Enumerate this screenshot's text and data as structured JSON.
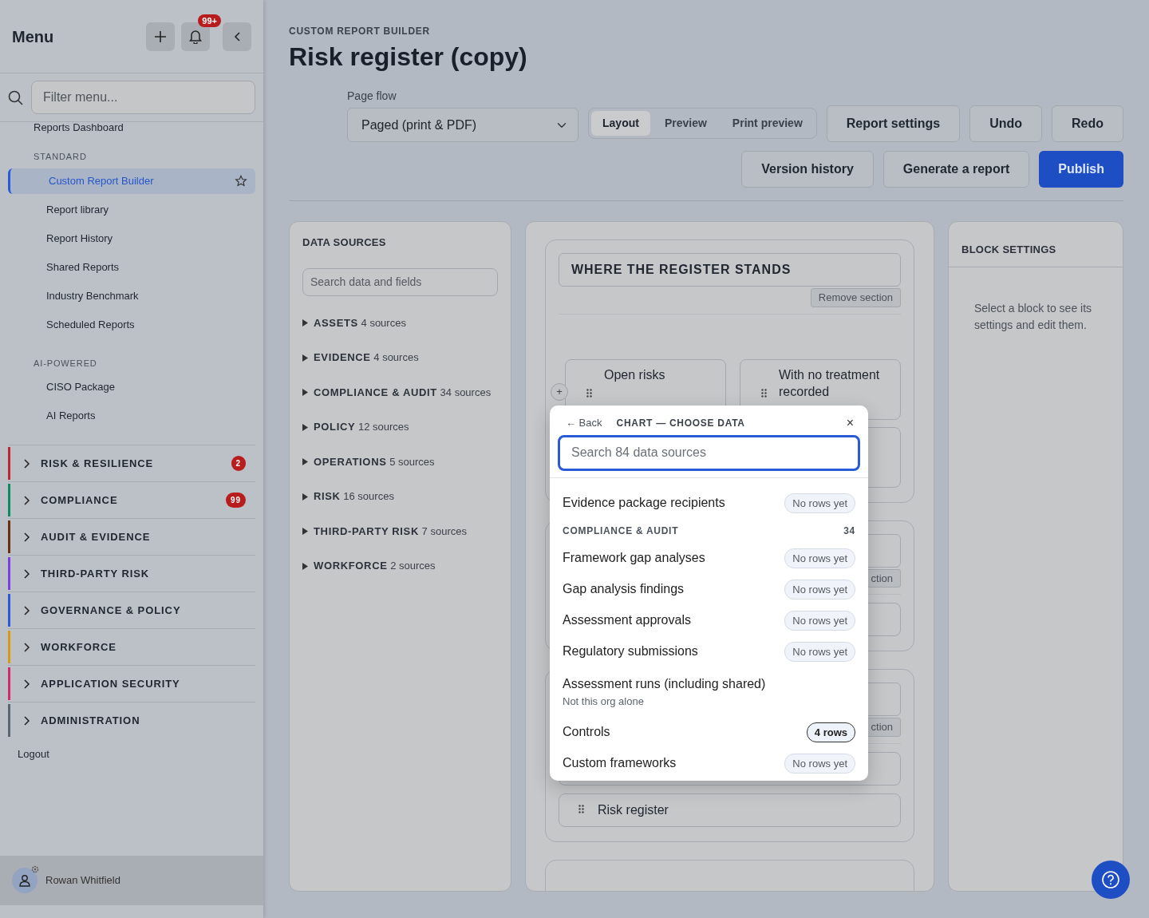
{
  "sidebar": {
    "title": "Menu",
    "notification_badge": "99+",
    "filter": {
      "placeholder": "Filter menu..."
    },
    "top_link": "Reports Dashboard",
    "sections": [
      {
        "heading": "STANDARD",
        "items": [
          {
            "label": "Custom Report Builder",
            "selected": true
          },
          {
            "label": "Report library",
            "selected": false
          },
          {
            "label": "Report History",
            "selected": false
          },
          {
            "label": "Shared Reports",
            "selected": false
          },
          {
            "label": "Industry Benchmark",
            "selected": false
          },
          {
            "label": "Scheduled Reports",
            "selected": false
          }
        ]
      },
      {
        "heading": "AI-POWERED",
        "items": [
          {
            "label": "CISO Package",
            "selected": false
          },
          {
            "label": "AI Reports",
            "selected": false
          }
        ]
      }
    ],
    "groups": [
      {
        "label": "RISK & RESILIENCE",
        "color": "#c0262d",
        "badge": "2"
      },
      {
        "label": "COMPLIANCE",
        "color": "#0e8a5f",
        "badge": "99"
      },
      {
        "label": "AUDIT & EVIDENCE",
        "color": "#6b2f12"
      },
      {
        "label": "THIRD-PARTY RISK",
        "color": "#7b3fe0"
      },
      {
        "label": "GOVERNANCE & POLICY",
        "color": "#2a5bd7"
      },
      {
        "label": "WORKFORCE",
        "color": "#d99a12"
      },
      {
        "label": "APPLICATION SECURITY",
        "color": "#d42a6a"
      },
      {
        "label": "ADMINISTRATION",
        "color": "#5b6472"
      }
    ],
    "logout": "Logout",
    "user": "Rowan Whitfield"
  },
  "header": {
    "eyebrow": "CUSTOM REPORT BUILDER",
    "title": "Risk register (copy)",
    "page_flow": {
      "label": "Page flow",
      "value": "Paged (print & PDF)"
    },
    "view_tabs": [
      {
        "label": "Layout",
        "selected": true
      },
      {
        "label": "Preview",
        "selected": false
      },
      {
        "label": "Print preview",
        "selected": false
      }
    ],
    "toolbar_buttons": [
      {
        "label": "Report settings",
        "kind": "outline"
      },
      {
        "label": "Undo",
        "kind": "outline"
      },
      {
        "label": "Redo",
        "kind": "outline"
      }
    ],
    "action_buttons": [
      {
        "label": "Version history",
        "kind": "outline"
      },
      {
        "label": "Generate a report",
        "kind": "outline"
      },
      {
        "label": "Publish",
        "kind": "primary"
      }
    ]
  },
  "data_sources": {
    "title": "DATA SOURCES",
    "search": {
      "placeholder": "Search data and fields"
    },
    "groups": [
      {
        "name": "ASSETS",
        "count": "4 sources"
      },
      {
        "name": "EVIDENCE",
        "count": "4 sources"
      },
      {
        "name": "COMPLIANCE & AUDIT",
        "count": "34 sources"
      },
      {
        "name": "POLICY",
        "count": "12 sources"
      },
      {
        "name": "OPERATIONS",
        "count": "5 sources"
      },
      {
        "name": "RISK",
        "count": "16 sources"
      },
      {
        "name": "THIRD-PARTY RISK",
        "count": "7 sources"
      },
      {
        "name": "WORKFORCE",
        "count": "2 sources"
      }
    ]
  },
  "canvas": {
    "sections": [
      {
        "title": "WHERE THE REGISTER STANDS",
        "remove": "Remove section",
        "add_block": "+",
        "blocks": [
          {
            "kind": "metric",
            "label": "Open risks"
          },
          {
            "kind": "metric",
            "label": "With no treatment recorded"
          },
          {
            "kind": "metric"
          }
        ]
      },
      {
        "remove": "ction",
        "blocks": [
          {
            "kind": "wide"
          }
        ]
      },
      {
        "remove": "ction",
        "blocks": [
          {
            "kind": "wide"
          },
          {
            "kind": "wide",
            "label": "Risk register"
          }
        ]
      },
      {
        "kind": "partial"
      }
    ]
  },
  "block_settings": {
    "title": "BLOCK SETTINGS",
    "hint": "Select a block to see its settings and edit them."
  },
  "popover": {
    "back": "← Back",
    "title": "CHART — CHOOSE DATA",
    "close": "×",
    "search": {
      "placeholder": "Search 84 data sources"
    },
    "items": [
      {
        "kind": "source",
        "name": "Evidence package recipients",
        "status": "No rows yet",
        "has_rows": false
      },
      {
        "kind": "group",
        "name": "COMPLIANCE & AUDIT",
        "count": "34"
      },
      {
        "kind": "source",
        "name": "Framework gap analyses",
        "status": "No rows yet",
        "has_rows": false
      },
      {
        "kind": "source",
        "name": "Gap analysis findings",
        "status": "No rows yet",
        "has_rows": false
      },
      {
        "kind": "source",
        "name": "Assessment approvals",
        "status": "No rows yet",
        "has_rows": false
      },
      {
        "kind": "source",
        "name": "Regulatory submissions",
        "status": "No rows yet",
        "has_rows": false
      },
      {
        "kind": "source",
        "name": "Assessment runs (including shared)",
        "note": "Not this org alone"
      },
      {
        "kind": "source",
        "name": "Controls",
        "status": "4 rows",
        "has_rows": true
      },
      {
        "kind": "source",
        "name": "Custom frameworks",
        "status": "No rows yet",
        "has_rows": false
      }
    ]
  }
}
